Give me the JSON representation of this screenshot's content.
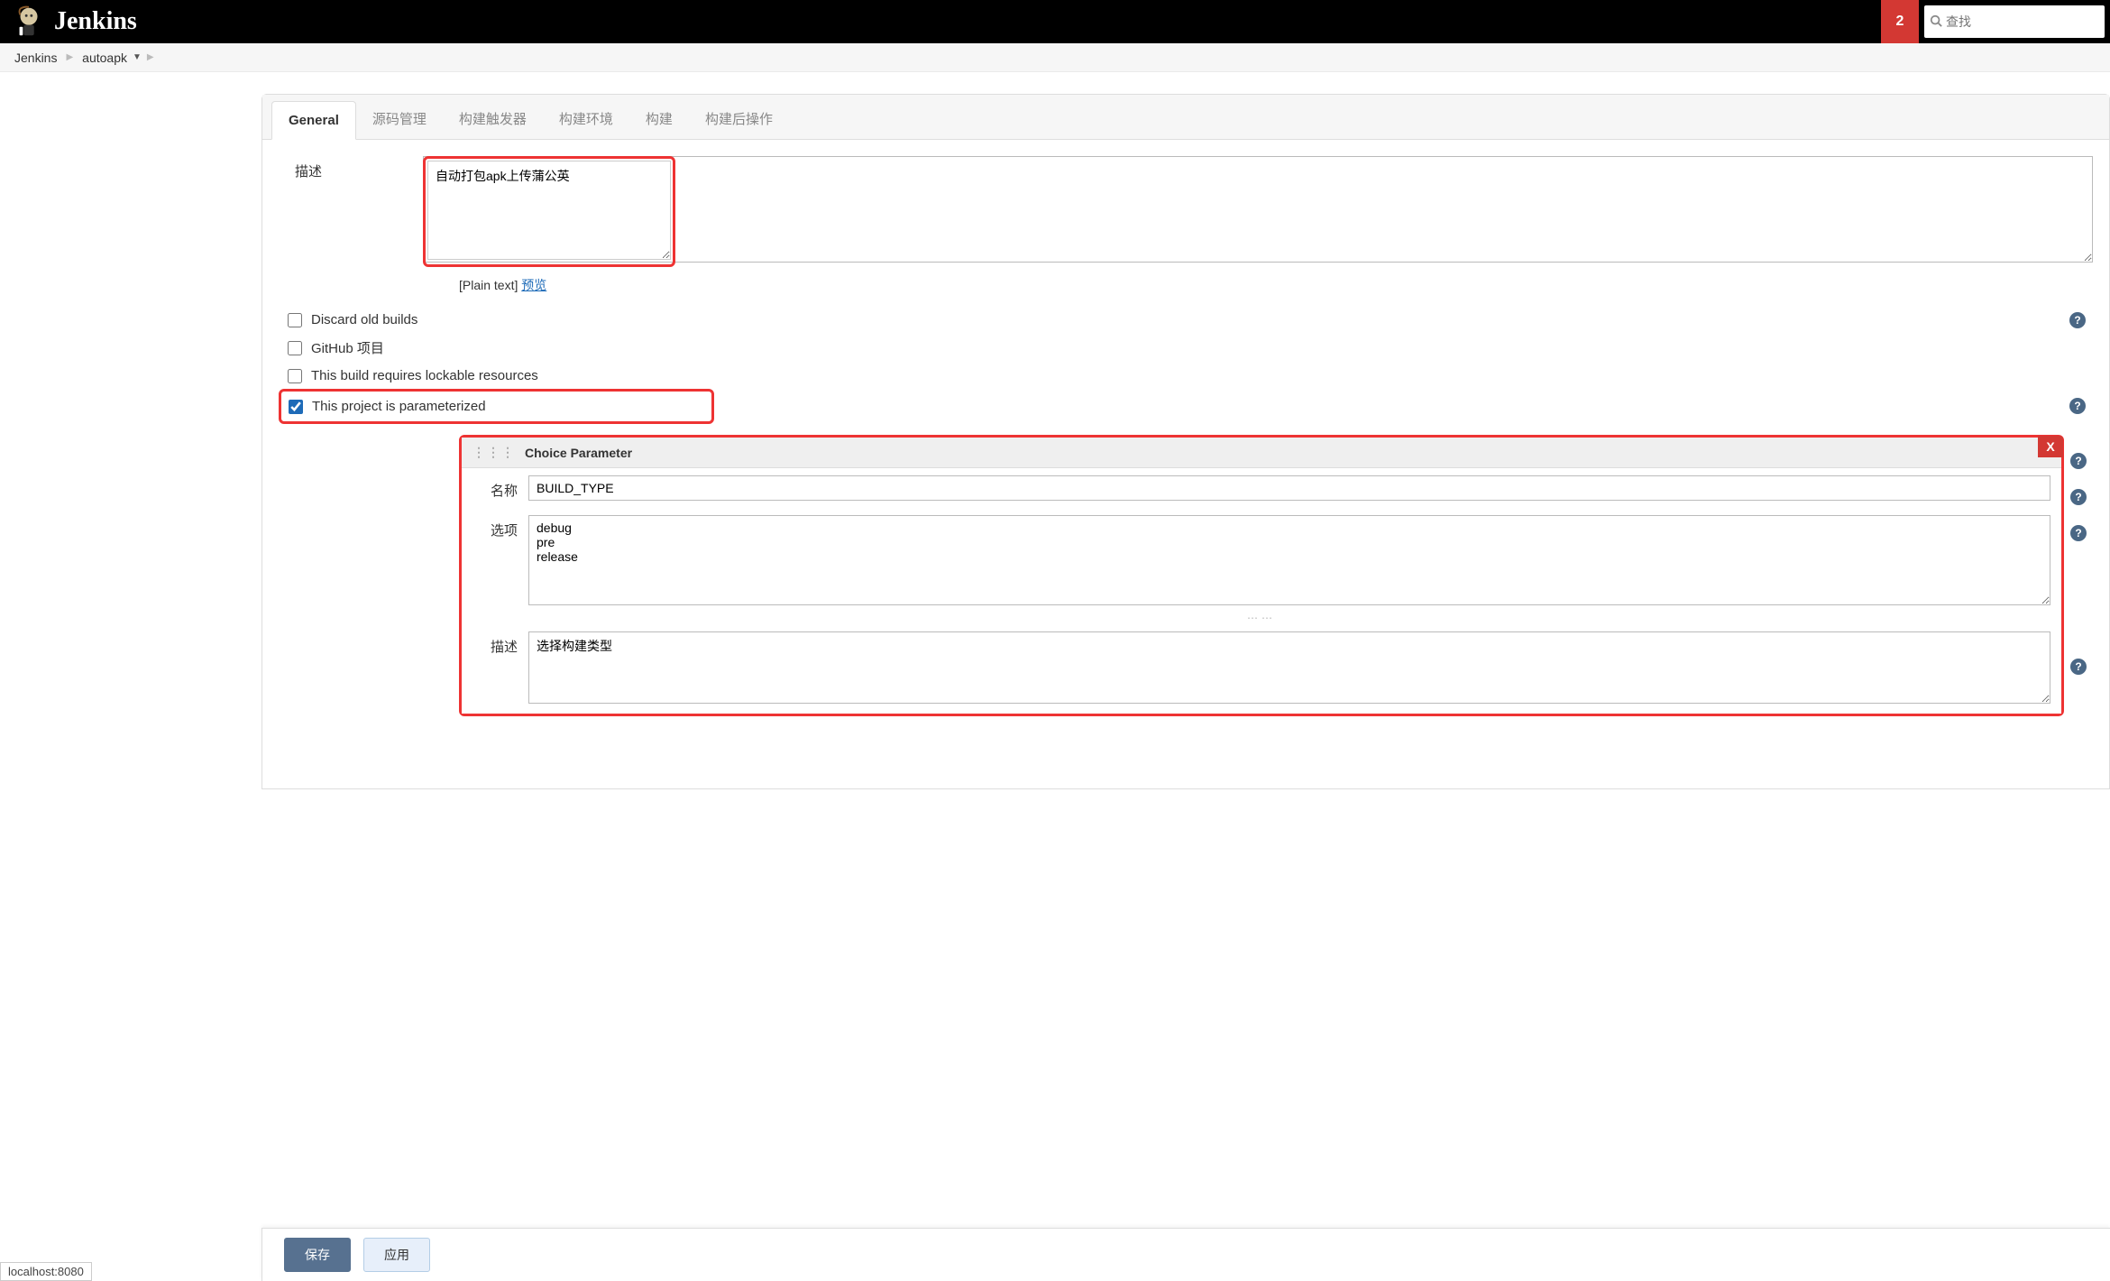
{
  "header": {
    "app_title": "Jenkins",
    "notification_count": "2",
    "search_placeholder": "查找"
  },
  "breadcrumb": {
    "items": [
      "Jenkins",
      "autoapk"
    ]
  },
  "tabs": {
    "items": [
      "General",
      "源码管理",
      "构建触发器",
      "构建环境",
      "构建",
      "构建后操作"
    ],
    "active_index": 0
  },
  "general": {
    "description_label": "描述",
    "description_value": "自动打包apk上传蒲公英",
    "plain_text_label": "[Plain text]",
    "preview_link": "预览",
    "checkboxes": [
      {
        "label": "Discard old builds",
        "checked": false,
        "has_help": true
      },
      {
        "label": "GitHub 项目",
        "checked": false,
        "has_help": false
      },
      {
        "label": "This build requires lockable resources",
        "checked": false,
        "has_help": false
      },
      {
        "label": "This project is parameterized",
        "checked": true,
        "has_help": true,
        "highlighted": true
      }
    ]
  },
  "parameter": {
    "header": "Choice Parameter",
    "close_label": "X",
    "name_label": "名称",
    "name_value": "BUILD_TYPE",
    "choices_label": "选项",
    "choices_value": "debug\npre\nrelease",
    "desc_label": "描述",
    "desc_value": "选择构建类型"
  },
  "buttons": {
    "save": "保存",
    "apply": "应用"
  },
  "status_bar": "localhost:8080"
}
